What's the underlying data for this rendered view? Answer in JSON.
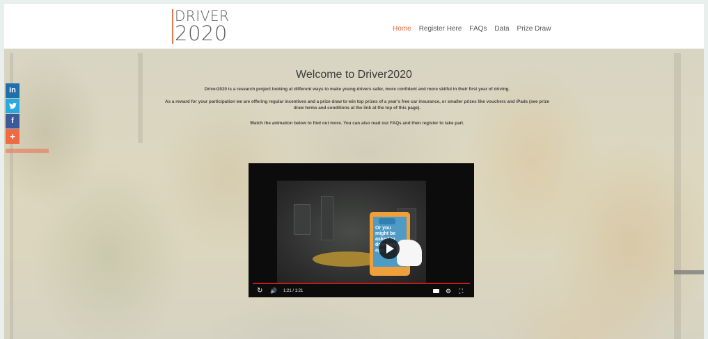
{
  "logo": {
    "line1": "DRIVER",
    "line2": "2020"
  },
  "nav": {
    "items": [
      "Home",
      "Register Here",
      "FAQs",
      "Data",
      "Prize Draw"
    ],
    "active": "Home"
  },
  "social": {
    "linkedin": "in",
    "twitter": "t",
    "facebook": "f",
    "more": "+"
  },
  "main": {
    "title": "Welcome to Driver2020",
    "p1": "Driver2020 is a research project looking at different ways to make young drivers safer, more confident and more skilful in their first year of driving.",
    "p2": "As a reward for your participation we are offering regular incentives and a prize draw to win top prizes of a year's free car insurance, or smaller prizes like vouchers and iPads (see prize draw terms and conditions at the link at the top of this page).",
    "p3": "Watch the animation below to find out more. You can also read our FAQs and then register to take part."
  },
  "video": {
    "screen_text": "Or you might be asked to download an app",
    "time": "1:21 / 1:21",
    "progress": 1.0
  },
  "colors": {
    "accent": "#e1683a",
    "progress": "#c41c1c"
  },
  "icons": [
    "linkedin-icon",
    "twitter-icon",
    "facebook-icon",
    "plus-icon",
    "play-icon",
    "replay-icon",
    "volume-icon",
    "cc-icon",
    "gear-icon",
    "fullscreen-icon"
  ]
}
